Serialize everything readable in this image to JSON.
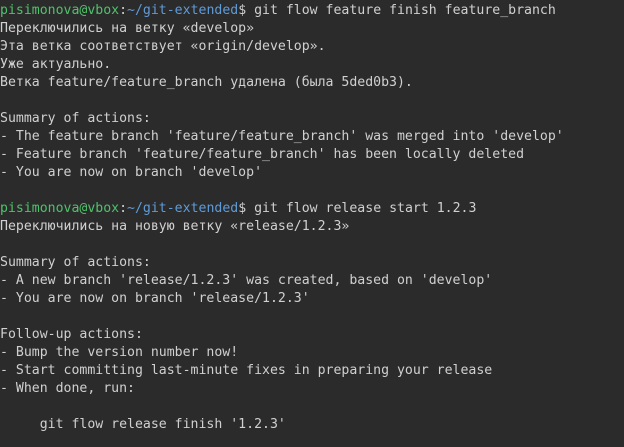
{
  "prompt": {
    "user_host": "pisimonova@vbox",
    "separator": ":",
    "path": "~/git-extended",
    "dollar": "$"
  },
  "terminal": {
    "lines": [
      {
        "type": "prompt",
        "cmd": " git flow feature finish feature_branch"
      },
      {
        "type": "out",
        "text": "Переключились на ветку «develop»"
      },
      {
        "type": "out",
        "text": "Эта ветка соответствует «origin/develop»."
      },
      {
        "type": "out",
        "text": "Уже актуально."
      },
      {
        "type": "out",
        "text": "Ветка feature/feature_branch удалена (была 5ded0b3)."
      },
      {
        "type": "blank"
      },
      {
        "type": "out",
        "text": "Summary of actions:"
      },
      {
        "type": "out",
        "text": "- The feature branch 'feature/feature_branch' was merged into 'develop'"
      },
      {
        "type": "out",
        "text": "- Feature branch 'feature/feature_branch' has been locally deleted"
      },
      {
        "type": "out",
        "text": "- You are now on branch 'develop'"
      },
      {
        "type": "blank"
      },
      {
        "type": "prompt",
        "cmd": " git flow release start 1.2.3"
      },
      {
        "type": "out",
        "text": "Переключились на новую ветку «release/1.2.3»"
      },
      {
        "type": "blank"
      },
      {
        "type": "out",
        "text": "Summary of actions:"
      },
      {
        "type": "out",
        "text": "- A new branch 'release/1.2.3' was created, based on 'develop'"
      },
      {
        "type": "out",
        "text": "- You are now on branch 'release/1.2.3'"
      },
      {
        "type": "blank"
      },
      {
        "type": "out",
        "text": "Follow-up actions:"
      },
      {
        "type": "out",
        "text": "- Bump the version number now!"
      },
      {
        "type": "out",
        "text": "- Start committing last-minute fixes in preparing your release"
      },
      {
        "type": "out",
        "text": "- When done, run:"
      },
      {
        "type": "blank"
      },
      {
        "type": "out",
        "text": "     git flow release finish '1.2.3'"
      }
    ]
  }
}
